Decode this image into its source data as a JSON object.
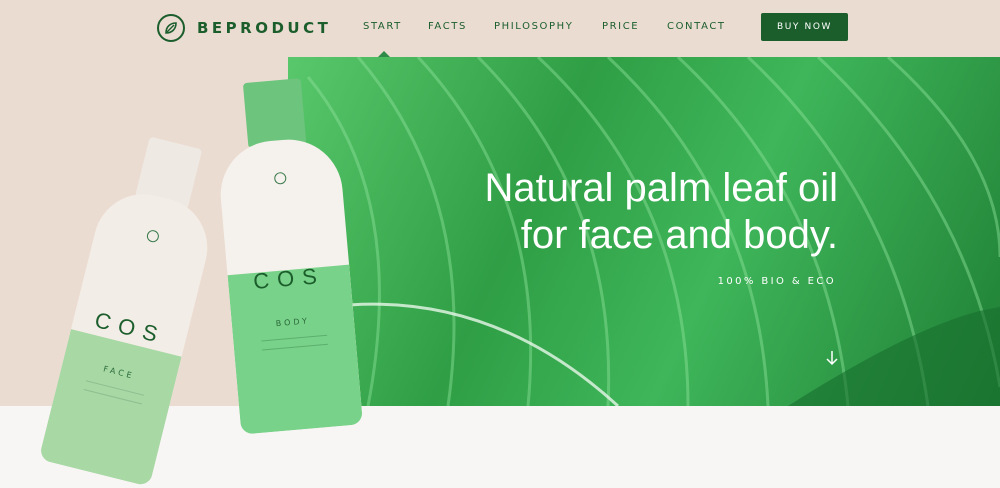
{
  "brand": {
    "name": "BEPRODUCT",
    "logo_icon": "leaf-icon"
  },
  "nav": {
    "items": [
      {
        "label": "START",
        "active": true
      },
      {
        "label": "FACTS"
      },
      {
        "label": "PHILOSOPHY"
      },
      {
        "label": "PRICE"
      },
      {
        "label": "CONTACT"
      }
    ],
    "cta_label": "BUY NOW"
  },
  "hero": {
    "headline_line1": "Natural palm leaf oil",
    "headline_line2": "for face and body.",
    "subheadline": "100% BIO & ECO",
    "scroll_icon": "arrow-down-icon"
  },
  "products": {
    "face": {
      "brand": "COS",
      "type": "FACE"
    },
    "body": {
      "brand": "COS",
      "type": "BODY"
    }
  },
  "colors": {
    "accent": "#1b5e2c",
    "leaf": "#3fb65a",
    "background": "#ebdcd2",
    "bottle_green": "#7fd68a"
  }
}
